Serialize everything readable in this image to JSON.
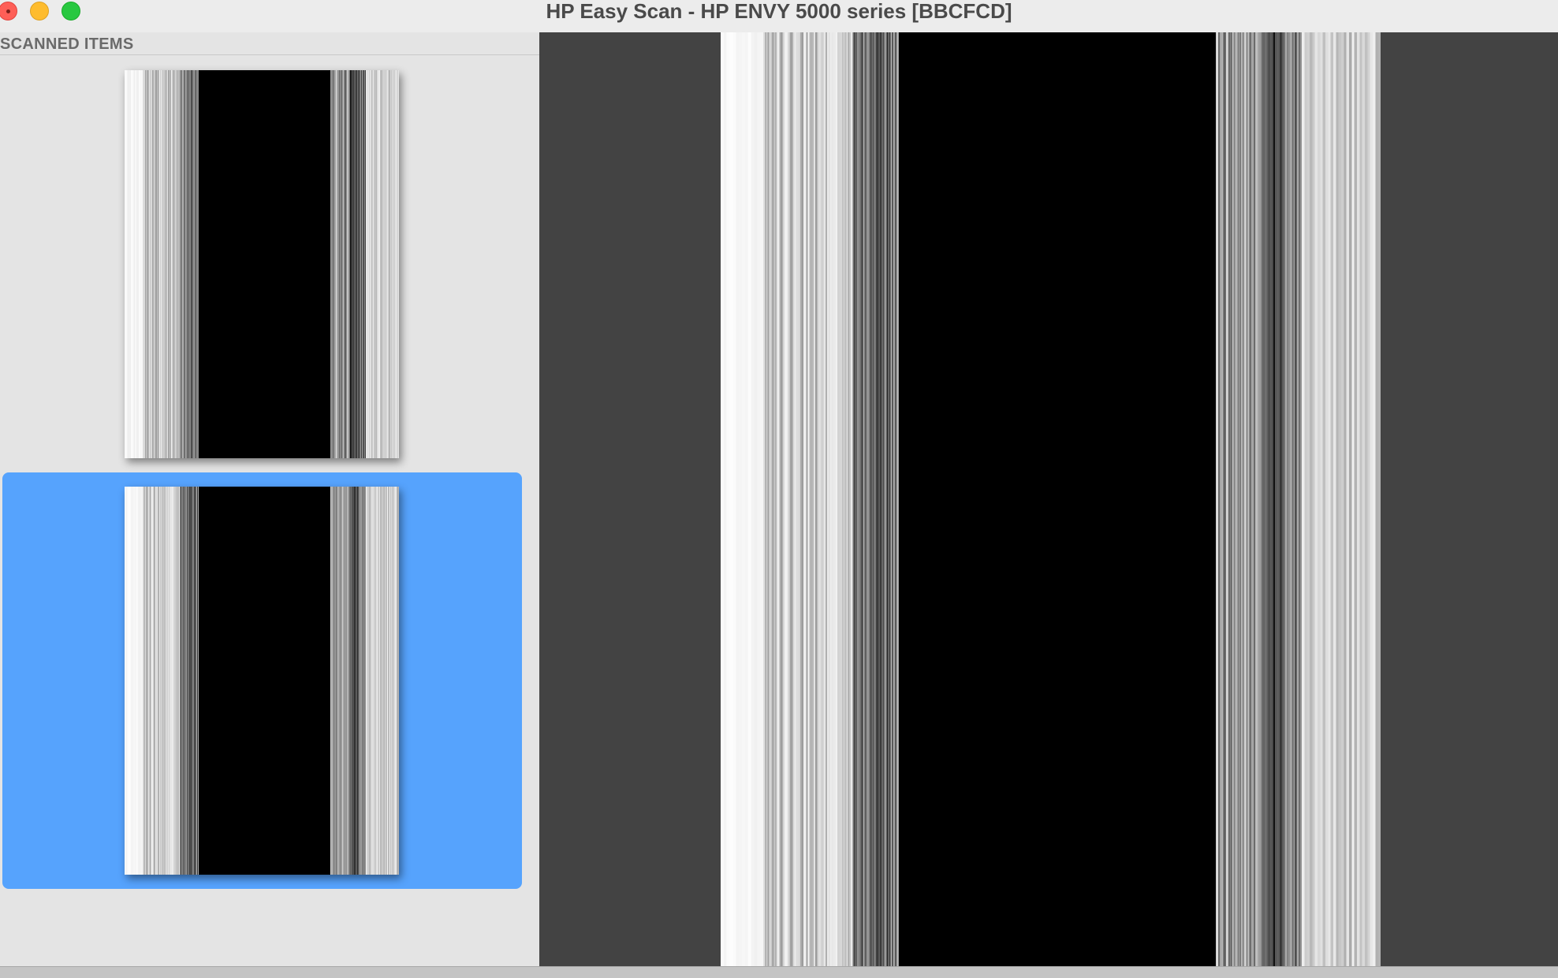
{
  "window": {
    "title": "HP Easy Scan - HP ENVY 5000 series [BBCFCD]"
  },
  "controls": {
    "close_icon": "close-icon",
    "minimize_icon": "minimize-icon",
    "zoom_icon": "zoom-icon"
  },
  "sidebar": {
    "header": "SCANNED ITEMS",
    "items": [
      {
        "selected": false
      },
      {
        "selected": true
      }
    ]
  },
  "colors": {
    "selection": "#56a3fd",
    "preview_background": "#434343",
    "close": "#fe5f57",
    "minimize": "#febc2e",
    "zoom": "#28c840"
  }
}
